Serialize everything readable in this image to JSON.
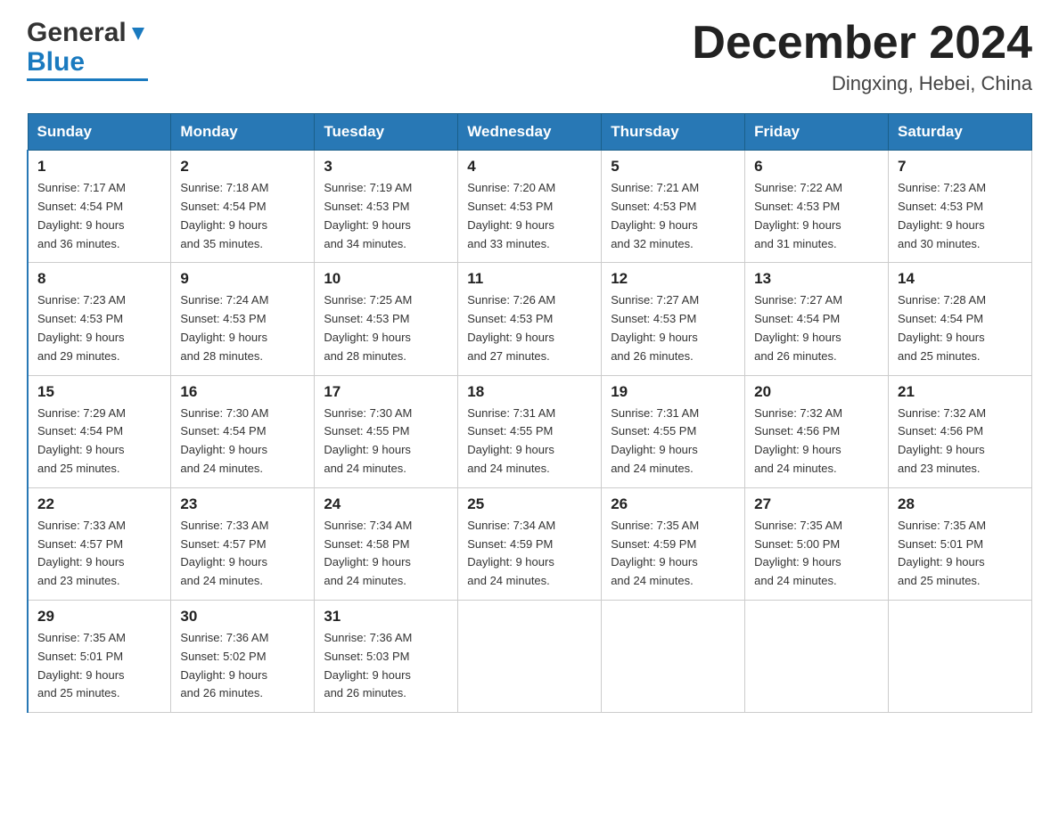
{
  "header": {
    "logo_general": "General",
    "logo_blue": "Blue",
    "month_title": "December 2024",
    "location": "Dingxing, Hebei, China"
  },
  "weekdays": [
    "Sunday",
    "Monday",
    "Tuesday",
    "Wednesday",
    "Thursday",
    "Friday",
    "Saturday"
  ],
  "weeks": [
    [
      {
        "day": "1",
        "sunrise": "7:17 AM",
        "sunset": "4:54 PM",
        "daylight": "9 hours and 36 minutes."
      },
      {
        "day": "2",
        "sunrise": "7:18 AM",
        "sunset": "4:54 PM",
        "daylight": "9 hours and 35 minutes."
      },
      {
        "day": "3",
        "sunrise": "7:19 AM",
        "sunset": "4:53 PM",
        "daylight": "9 hours and 34 minutes."
      },
      {
        "day": "4",
        "sunrise": "7:20 AM",
        "sunset": "4:53 PM",
        "daylight": "9 hours and 33 minutes."
      },
      {
        "day": "5",
        "sunrise": "7:21 AM",
        "sunset": "4:53 PM",
        "daylight": "9 hours and 32 minutes."
      },
      {
        "day": "6",
        "sunrise": "7:22 AM",
        "sunset": "4:53 PM",
        "daylight": "9 hours and 31 minutes."
      },
      {
        "day": "7",
        "sunrise": "7:23 AM",
        "sunset": "4:53 PM",
        "daylight": "9 hours and 30 minutes."
      }
    ],
    [
      {
        "day": "8",
        "sunrise": "7:23 AM",
        "sunset": "4:53 PM",
        "daylight": "9 hours and 29 minutes."
      },
      {
        "day": "9",
        "sunrise": "7:24 AM",
        "sunset": "4:53 PM",
        "daylight": "9 hours and 28 minutes."
      },
      {
        "day": "10",
        "sunrise": "7:25 AM",
        "sunset": "4:53 PM",
        "daylight": "9 hours and 28 minutes."
      },
      {
        "day": "11",
        "sunrise": "7:26 AM",
        "sunset": "4:53 PM",
        "daylight": "9 hours and 27 minutes."
      },
      {
        "day": "12",
        "sunrise": "7:27 AM",
        "sunset": "4:53 PM",
        "daylight": "9 hours and 26 minutes."
      },
      {
        "day": "13",
        "sunrise": "7:27 AM",
        "sunset": "4:54 PM",
        "daylight": "9 hours and 26 minutes."
      },
      {
        "day": "14",
        "sunrise": "7:28 AM",
        "sunset": "4:54 PM",
        "daylight": "9 hours and 25 minutes."
      }
    ],
    [
      {
        "day": "15",
        "sunrise": "7:29 AM",
        "sunset": "4:54 PM",
        "daylight": "9 hours and 25 minutes."
      },
      {
        "day": "16",
        "sunrise": "7:30 AM",
        "sunset": "4:54 PM",
        "daylight": "9 hours and 24 minutes."
      },
      {
        "day": "17",
        "sunrise": "7:30 AM",
        "sunset": "4:55 PM",
        "daylight": "9 hours and 24 minutes."
      },
      {
        "day": "18",
        "sunrise": "7:31 AM",
        "sunset": "4:55 PM",
        "daylight": "9 hours and 24 minutes."
      },
      {
        "day": "19",
        "sunrise": "7:31 AM",
        "sunset": "4:55 PM",
        "daylight": "9 hours and 24 minutes."
      },
      {
        "day": "20",
        "sunrise": "7:32 AM",
        "sunset": "4:56 PM",
        "daylight": "9 hours and 24 minutes."
      },
      {
        "day": "21",
        "sunrise": "7:32 AM",
        "sunset": "4:56 PM",
        "daylight": "9 hours and 23 minutes."
      }
    ],
    [
      {
        "day": "22",
        "sunrise": "7:33 AM",
        "sunset": "4:57 PM",
        "daylight": "9 hours and 23 minutes."
      },
      {
        "day": "23",
        "sunrise": "7:33 AM",
        "sunset": "4:57 PM",
        "daylight": "9 hours and 24 minutes."
      },
      {
        "day": "24",
        "sunrise": "7:34 AM",
        "sunset": "4:58 PM",
        "daylight": "9 hours and 24 minutes."
      },
      {
        "day": "25",
        "sunrise": "7:34 AM",
        "sunset": "4:59 PM",
        "daylight": "9 hours and 24 minutes."
      },
      {
        "day": "26",
        "sunrise": "7:35 AM",
        "sunset": "4:59 PM",
        "daylight": "9 hours and 24 minutes."
      },
      {
        "day": "27",
        "sunrise": "7:35 AM",
        "sunset": "5:00 PM",
        "daylight": "9 hours and 24 minutes."
      },
      {
        "day": "28",
        "sunrise": "7:35 AM",
        "sunset": "5:01 PM",
        "daylight": "9 hours and 25 minutes."
      }
    ],
    [
      {
        "day": "29",
        "sunrise": "7:35 AM",
        "sunset": "5:01 PM",
        "daylight": "9 hours and 25 minutes."
      },
      {
        "day": "30",
        "sunrise": "7:36 AM",
        "sunset": "5:02 PM",
        "daylight": "9 hours and 26 minutes."
      },
      {
        "day": "31",
        "sunrise": "7:36 AM",
        "sunset": "5:03 PM",
        "daylight": "9 hours and 26 minutes."
      },
      null,
      null,
      null,
      null
    ]
  ],
  "labels": {
    "sunrise": "Sunrise:",
    "sunset": "Sunset:",
    "daylight": "Daylight:"
  }
}
